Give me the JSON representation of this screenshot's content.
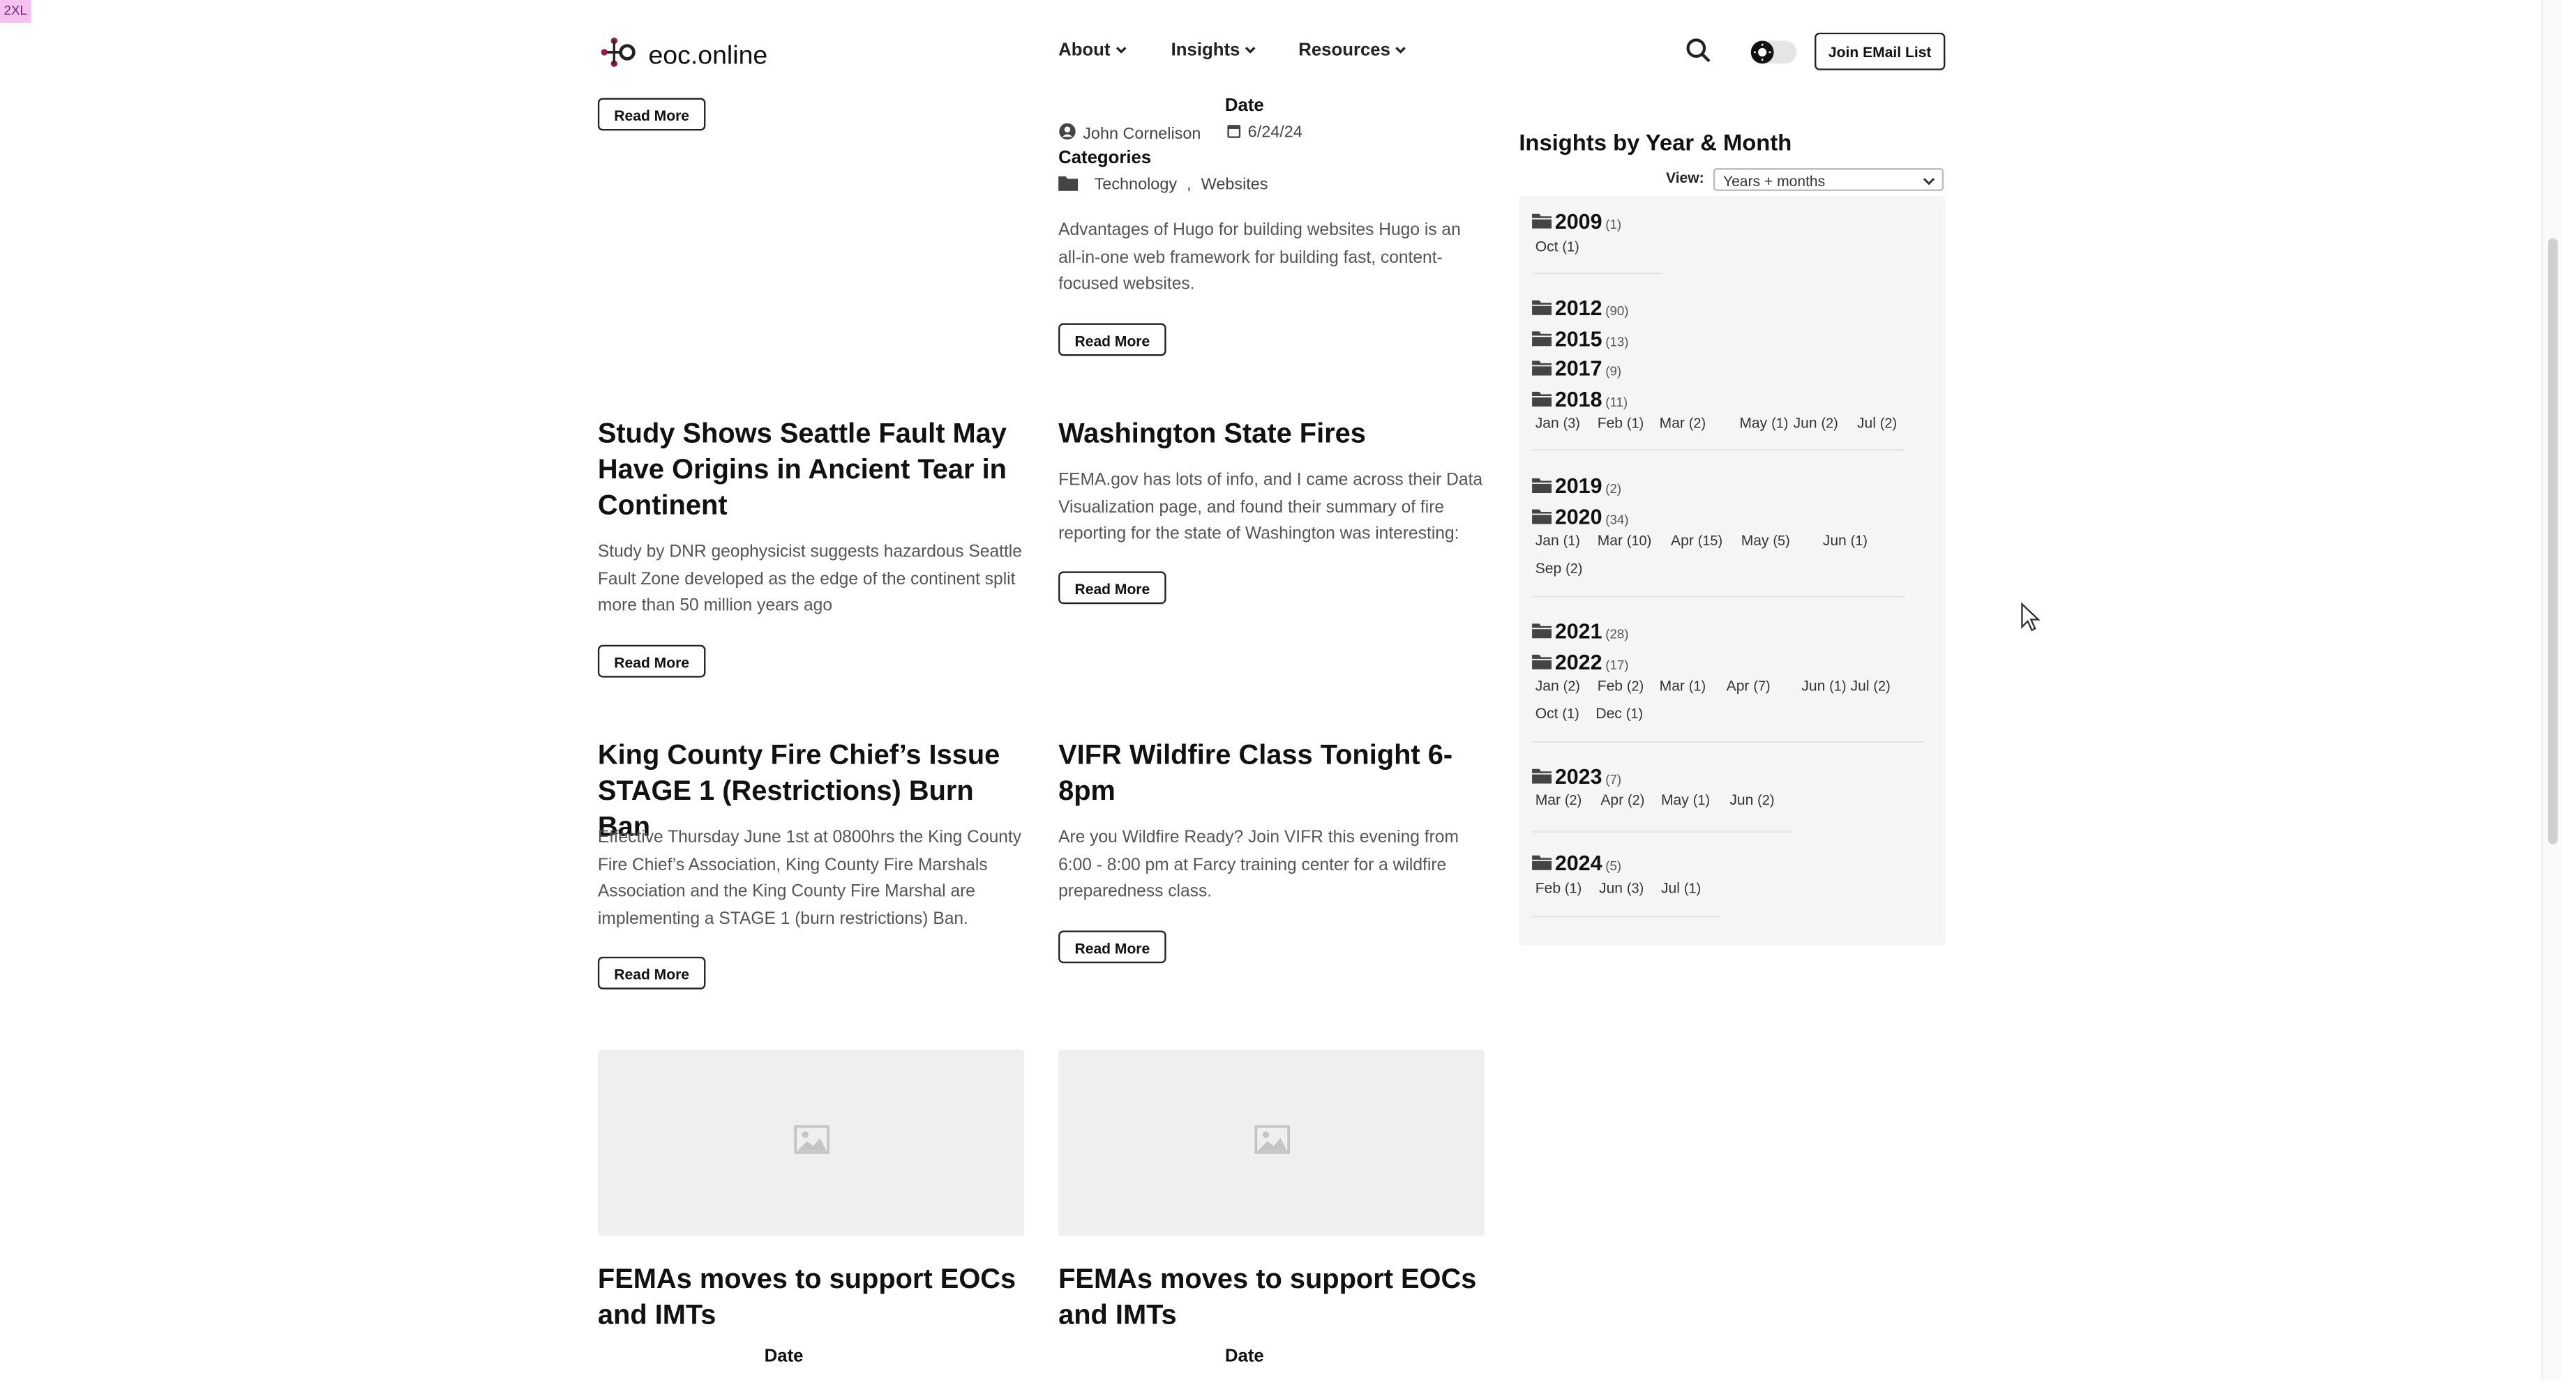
{
  "breakpoint": "2XL",
  "header": {
    "logo_text": "eoc.online",
    "nav": [
      {
        "label": "About"
      },
      {
        "label": "Insights"
      },
      {
        "label": "Resources"
      }
    ],
    "join_label": "Join EMail List"
  },
  "posts": {
    "read_more": "Read More",
    "top_left": {},
    "hugo": {
      "date_label": "Date",
      "author": "John Cornelison",
      "date": "6/24/24",
      "categories_label": "Categories",
      "category_1": "Technology",
      "category_sep": ",",
      "category_2": "Websites",
      "excerpt": "Advantages of Hugo for building websites Hugo is an all-in-one web framework for building fast, content-focused websites."
    },
    "seattle": {
      "title": "Study Shows Seattle Fault May Have Origins in Ancient Tear in Continent",
      "excerpt": "Study by DNR geophysicist suggests hazardous Seattle Fault Zone developed as the edge of the continent split more than 50 million years ago"
    },
    "wa_fires": {
      "title": "Washington State Fires",
      "excerpt": "FEMA.gov has lots of info, and I came across their Data Visualization page, and found their summary of fire reporting for the state of Washington was interesting:"
    },
    "burn_ban": {
      "title": "King County Fire Chief’s Issue STAGE 1 (Restrictions) Burn Ban",
      "excerpt": "Effective Thursday June 1st at 0800hrs the King County Fire Chief’s Association, King County Fire Marshals Association and the King County Fire Marshal are implementing a STAGE 1 (burn restrictions) Ban."
    },
    "vifr": {
      "title": "VIFR Wildfire Class Tonight 6-8pm",
      "excerpt": "Are you Wildfire Ready? Join VIFR this evening from 6:00 - 8:00 pm at Farcy training center for a wildfire preparedness class."
    },
    "fema_left": {
      "title": "FEMAs moves to support EOCs and IMTs",
      "date_label": "Date"
    },
    "fema_right": {
      "title": "FEMAs moves to support EOCs and IMTs",
      "date_label": "Date"
    }
  },
  "sidebar": {
    "title": "Insights by Year & Month",
    "view_label": "View:",
    "view_value": "Years + months",
    "years": [
      {
        "year": "2009",
        "count": "(1)",
        "months": [
          {
            "m": "Oct",
            "c": "(1)"
          }
        ]
      },
      {
        "year": "2012",
        "count": "(90)",
        "months": []
      },
      {
        "year": "2015",
        "count": "(13)",
        "months": []
      },
      {
        "year": "2017",
        "count": "(9)",
        "months": []
      },
      {
        "year": "2018",
        "count": "(11)",
        "months": [
          {
            "m": "Jan",
            "c": "(3)"
          },
          {
            "m": "Feb",
            "c": "(1)"
          },
          {
            "m": "Mar",
            "c": "(2)"
          },
          {
            "m": "May",
            "c": "(1)"
          },
          {
            "m": "Jun",
            "c": "(2)"
          },
          {
            "m": "Jul",
            "c": "(2)"
          }
        ]
      },
      {
        "year": "2019",
        "count": "(2)",
        "months": []
      },
      {
        "year": "2020",
        "count": "(34)",
        "months": [
          {
            "m": "Jan",
            "c": "(1)"
          },
          {
            "m": "Mar",
            "c": "(10)"
          },
          {
            "m": "Apr",
            "c": "(15)"
          },
          {
            "m": "May",
            "c": "(5)"
          },
          {
            "m": "Jun",
            "c": "(1)"
          },
          {
            "m": "Sep",
            "c": "(2)"
          }
        ]
      },
      {
        "year": "2021",
        "count": "(28)",
        "months": []
      },
      {
        "year": "2022",
        "count": "(17)",
        "months": [
          {
            "m": "Jan",
            "c": "(2)"
          },
          {
            "m": "Feb",
            "c": "(2)"
          },
          {
            "m": "Mar",
            "c": "(1)"
          },
          {
            "m": "Apr",
            "c": "(7)"
          },
          {
            "m": "Jun",
            "c": "(1)"
          },
          {
            "m": "Jul",
            "c": "(2)"
          },
          {
            "m": "Oct",
            "c": "(1)"
          },
          {
            "m": "Dec",
            "c": "(1)"
          }
        ]
      },
      {
        "year": "2023",
        "count": "(7)",
        "months": [
          {
            "m": "Mar",
            "c": "(2)"
          },
          {
            "m": "Apr",
            "c": "(2)"
          },
          {
            "m": "May",
            "c": "(1)"
          },
          {
            "m": "Jun",
            "c": "(2)"
          }
        ]
      },
      {
        "year": "2024",
        "count": "(5)",
        "months": [
          {
            "m": "Feb",
            "c": "(1)"
          },
          {
            "m": "Jun",
            "c": "(3)"
          },
          {
            "m": "Jul",
            "c": "(1)"
          }
        ]
      }
    ]
  },
  "colors": {
    "accent": "#8e1f4a",
    "text": "#111111",
    "muted": "#555555",
    "panel": "#f5f5f5"
  },
  "icons": [
    "logo-icon",
    "search-icon",
    "theme-toggle-icon",
    "user-icon",
    "calendar-icon",
    "folder-icon",
    "image-placeholder-icon",
    "chevron-down-icon",
    "cursor-icon"
  ]
}
